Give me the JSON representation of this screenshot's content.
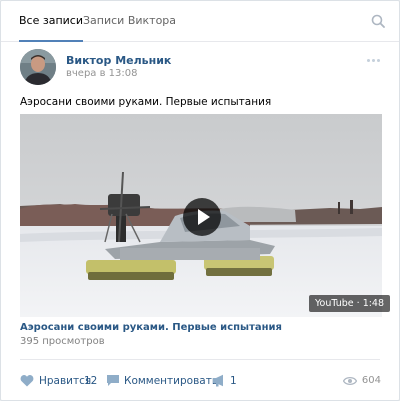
{
  "tabs": [
    {
      "label": "Все записи",
      "active": true
    },
    {
      "label": "Записи Виктора",
      "active": false
    }
  ],
  "search_icon": "search-icon",
  "post": {
    "author": "Виктор Мельник",
    "time": "вчера в 13:08",
    "text": "Аэросани своими руками. Первые испытания",
    "video": {
      "badge": "YouTube · 1:48",
      "title": "Аэросани своими руками. Первые испытания",
      "views": "395 просмотров"
    },
    "actions": {
      "like_label": "Нравится",
      "like_count": "12",
      "comment_label": "Комментировать",
      "share_count": "1",
      "views_count": "604"
    }
  },
  "colors": {
    "link": "#2a5885",
    "accent": "#5181b8",
    "icon": "#8fadc8",
    "muted": "#939393"
  }
}
